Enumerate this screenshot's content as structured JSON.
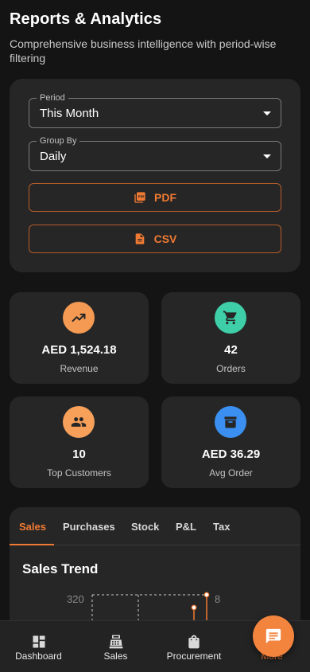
{
  "header": {
    "title": "Reports & Analytics",
    "subtitle": "Comprehensive business intelligence with period-wise filtering"
  },
  "filters": {
    "period": {
      "label": "Period",
      "value": "This Month"
    },
    "group_by": {
      "label": "Group By",
      "value": "Daily"
    },
    "export_pdf": "PDF",
    "export_csv": "CSV"
  },
  "stats": [
    {
      "value": "AED 1,524.18",
      "label": "Revenue",
      "icon": "trending-up-icon",
      "color": "#f59a52"
    },
    {
      "value": "42",
      "label": "Orders",
      "icon": "cart-icon",
      "color": "#3ecfa8"
    },
    {
      "value": "10",
      "label": "Top Customers",
      "icon": "group-icon",
      "color": "#f6a05a"
    },
    {
      "value": "AED 36.29",
      "label": "Avg Order",
      "icon": "archive-icon",
      "color": "#3b8ff0"
    }
  ],
  "report": {
    "tabs": [
      "Sales",
      "Purchases",
      "Stock",
      "P&L",
      "Tax"
    ],
    "active_tab": "Sales",
    "section_title": "Sales Trend"
  },
  "chart_data": {
    "type": "line",
    "title": "Sales Trend",
    "y_left_tick": "320",
    "y_right_tick": "8"
  },
  "bottom_nav": {
    "items": [
      {
        "label": "Dashboard",
        "icon": "dashboard-icon"
      },
      {
        "label": "Sales",
        "icon": "cash-register-icon"
      },
      {
        "label": "Procurement",
        "icon": "shopping-bag-icon"
      },
      {
        "label": "More",
        "icon": "more-icon"
      }
    ],
    "active": "More"
  },
  "fab": {
    "icon": "chat-icon"
  },
  "colors": {
    "accent": "#f07a33",
    "card_bg": "#262626",
    "page_bg": "#141414"
  }
}
